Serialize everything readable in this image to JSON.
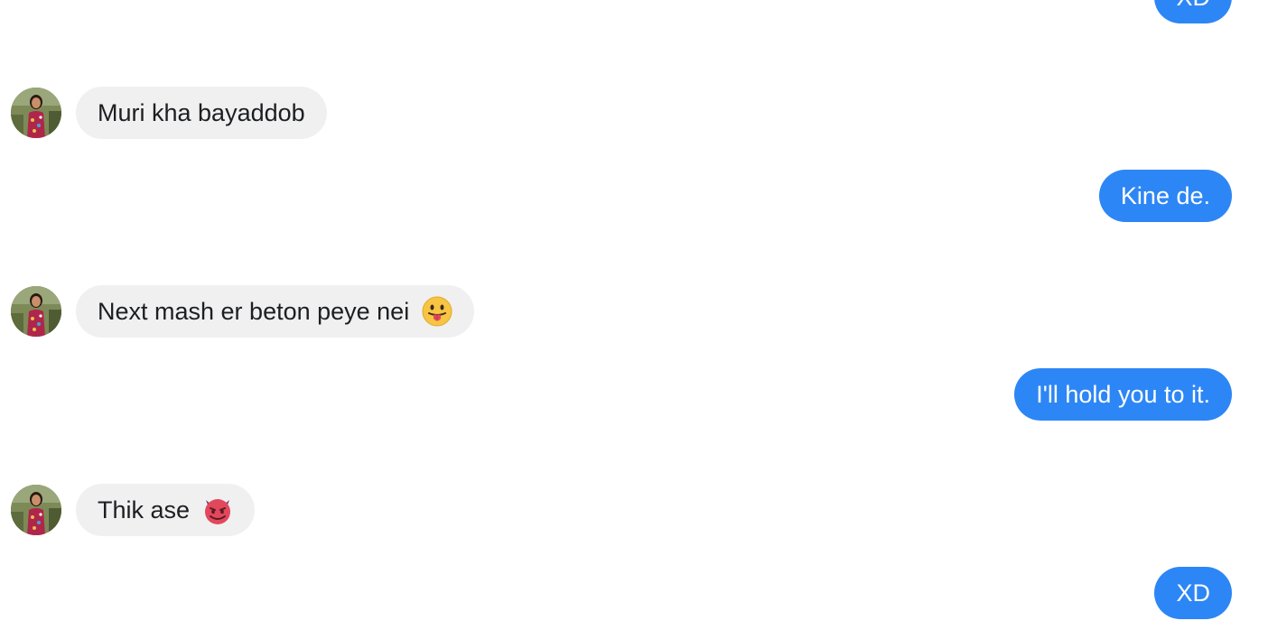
{
  "contact": {
    "avatar_icon": "contact-avatar"
  },
  "colors": {
    "incoming_bubble": "#f0f0f0",
    "outgoing_bubble": "#2d86f5"
  },
  "messages": [
    {
      "direction": "out",
      "text": "XD"
    },
    {
      "direction": "in",
      "text": "Muri kha bayaddob"
    },
    {
      "direction": "out",
      "text": "Kine de."
    },
    {
      "direction": "in",
      "text": "Next mash er beton peye nei",
      "emoji": "tongue-out-emoji"
    },
    {
      "direction": "out",
      "text": "I'll hold you to it."
    },
    {
      "direction": "in",
      "text": "Thik ase",
      "emoji": "smiling-devil-emoji"
    },
    {
      "direction": "out",
      "text": "XD"
    }
  ]
}
